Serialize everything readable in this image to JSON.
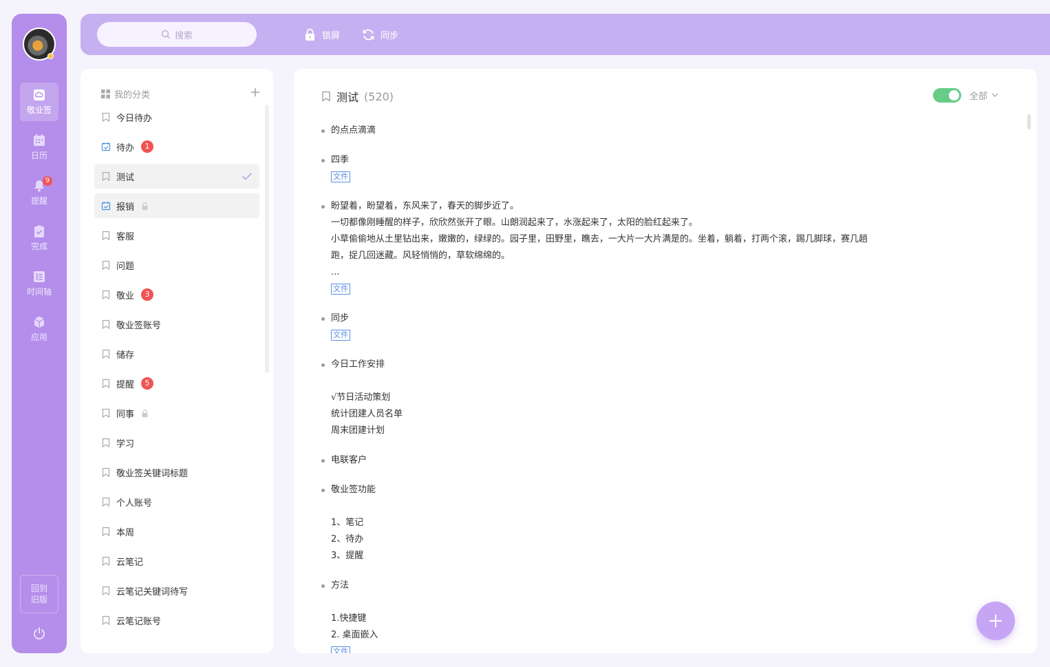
{
  "nav": {
    "items": [
      {
        "label": "敬业签",
        "icon": "cloud-note-icon",
        "active": true
      },
      {
        "label": "日历",
        "icon": "calendar-icon"
      },
      {
        "label": "提醒",
        "icon": "bell-icon",
        "badge": "9"
      },
      {
        "label": "完成",
        "icon": "done-clipboard-icon"
      },
      {
        "label": "时间轴",
        "icon": "timeline-icon"
      },
      {
        "label": "应用",
        "icon": "cube-icon"
      }
    ],
    "old_version": "回到旧版",
    "colors": {
      "rail": "#b48eea",
      "topbar": "#c7b0f1",
      "badge": "#f05454",
      "toggle": "#66cc88",
      "file_tag": "#5b8de6"
    }
  },
  "topbar": {
    "search_placeholder": "搜索",
    "lock_label": "锁屏",
    "sync_label": "同步"
  },
  "categories": {
    "header": "我的分类",
    "items": [
      {
        "label": "今日待办",
        "icon": "bookmark-icon"
      },
      {
        "label": "待办",
        "icon": "todo-check-icon",
        "badge": "1"
      },
      {
        "label": "测试",
        "icon": "bookmark-icon",
        "selected": true
      },
      {
        "label": "报销",
        "icon": "todo-check-icon",
        "locked": true
      },
      {
        "label": "客服",
        "icon": "bookmark-icon"
      },
      {
        "label": "问题",
        "icon": "bookmark-icon"
      },
      {
        "label": "敬业",
        "icon": "bookmark-icon",
        "badge": "3"
      },
      {
        "label": "敬业签账号",
        "icon": "bookmark-icon"
      },
      {
        "label": "储存",
        "icon": "bookmark-icon"
      },
      {
        "label": "提醒",
        "icon": "bookmark-icon",
        "badge": "5"
      },
      {
        "label": "同事",
        "icon": "bookmark-icon",
        "locked": true
      },
      {
        "label": "学习",
        "icon": "bookmark-icon"
      },
      {
        "label": "敬业签关键词标题",
        "icon": "bookmark-icon"
      },
      {
        "label": "个人账号",
        "icon": "bookmark-icon"
      },
      {
        "label": "本周",
        "icon": "bookmark-icon"
      },
      {
        "label": "云笔记",
        "icon": "bookmark-icon"
      },
      {
        "label": "云笔记关键词待写",
        "icon": "bookmark-icon"
      },
      {
        "label": "云笔记账号",
        "icon": "bookmark-icon"
      }
    ]
  },
  "main": {
    "title": "测试",
    "count": "(520)",
    "filter_label": "全部",
    "show_toggle_on": true,
    "file_label": "文件",
    "notes": [
      {
        "lines": [
          "的点点滴滴"
        ],
        "file": false
      },
      {
        "lines": [
          "四季"
        ],
        "file": true
      },
      {
        "lines": [
          "盼望着，盼望着，东风来了，春天的脚步近了。",
          "一切都像刚睡醒的样子，欣欣然张开了眼。山朗润起来了，水涨起来了，太阳的脸红起来了。",
          "小草偷偷地从土里钻出来，嫩嫩的，绿绿的。园子里，田野里，瞧去，一大片一大片满是的。坐着，躺着，打两个滚，踢几脚球，赛几趟",
          "跑，捉几回迷藏。风轻悄悄的，草软绵绵的。",
          "..."
        ],
        "file": true
      },
      {
        "lines": [
          "同步"
        ],
        "file": true
      },
      {
        "lines": [
          "今日工作安排",
          "",
          "√节日活动策划",
          "统计团建人员名单",
          "周末团建计划"
        ],
        "file": false
      },
      {
        "lines": [
          "电联客户"
        ],
        "file": false
      },
      {
        "lines": [
          "敬业签功能",
          "",
          "1、笔记",
          "2、待办",
          "3、提醒"
        ],
        "file": false
      },
      {
        "lines": [
          "方法",
          "",
          "1.快捷键",
          "2. 桌面嵌入"
        ],
        "file": true
      }
    ]
  }
}
